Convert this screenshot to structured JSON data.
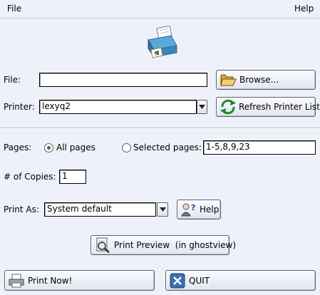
{
  "menu": {
    "file": "File",
    "help": "Help"
  },
  "file_row": {
    "label": "File:",
    "value": "",
    "browse_button": "Browse..."
  },
  "printer_row": {
    "label": "Printer:",
    "value": "lexyq2",
    "refresh_button": "Refresh Printer List"
  },
  "pages_row": {
    "label": "Pages:",
    "all_pages": "All pages",
    "selected_pages": "Selected pages:",
    "selected_pages_value": "1-5,8,9,23",
    "selection": "all"
  },
  "copies_row": {
    "label": "# of Copies:",
    "value": "1"
  },
  "print_as_row": {
    "label": "Print As:",
    "value": "System default",
    "help_button": "Help"
  },
  "preview_button": "Print Preview  (in ghostview)",
  "print_now_button": "Print Now!",
  "quit_button": "QUIT",
  "colors": {
    "background": "#eff1fa",
    "radio_dot": "#2f7a2f"
  }
}
